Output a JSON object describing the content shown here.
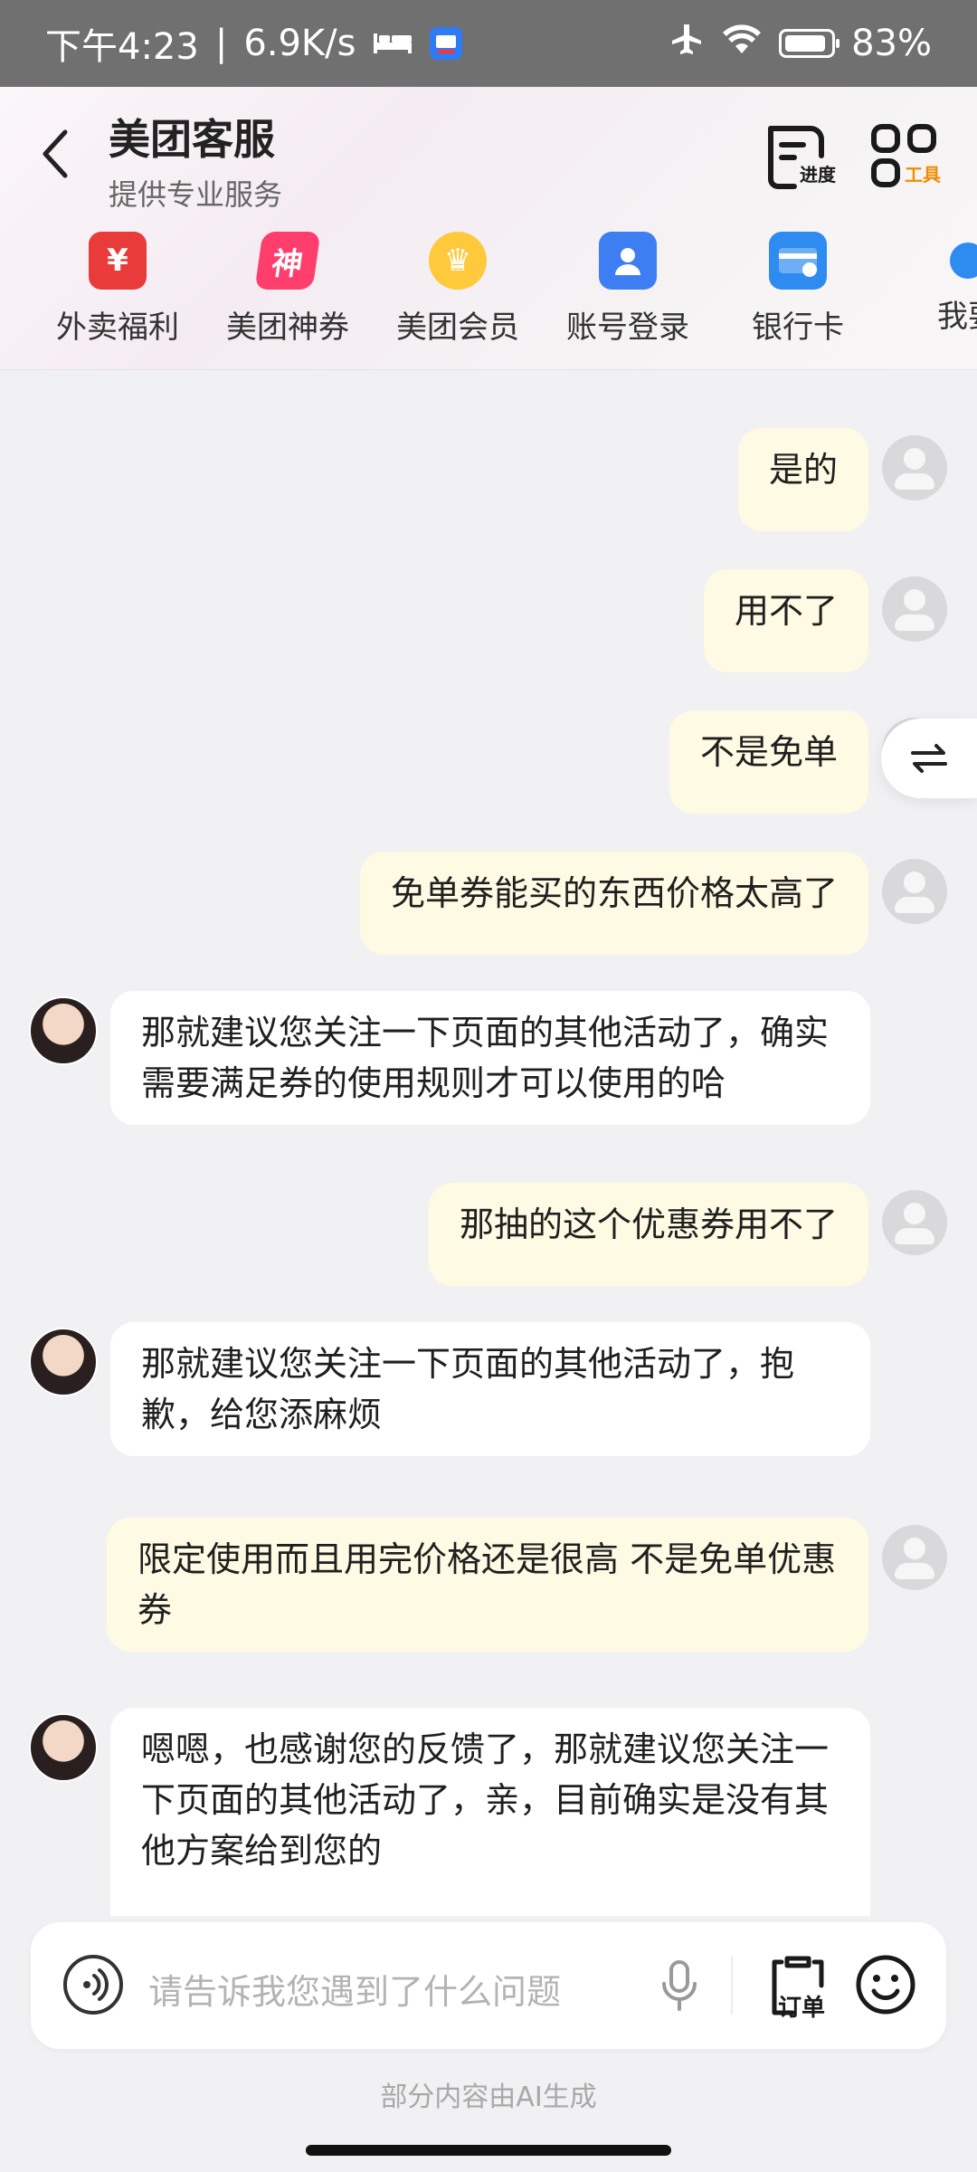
{
  "status_bar": {
    "time": "下午4:23",
    "net_speed": "6.9K/s",
    "battery": "83%"
  },
  "header": {
    "title": "美团客服",
    "subtitle": "提供专业服务",
    "tools": [
      {
        "label": "进度",
        "color": "#1a1a1a"
      },
      {
        "label": "工具",
        "color": "#f08c00"
      }
    ],
    "quick_items": [
      {
        "label": "外卖福利",
        "icon": "red-envelope-icon",
        "color": "#ea3b3b",
        "glyph": "¥"
      },
      {
        "label": "美团神券",
        "icon": "coupon-icon",
        "color": "#ff3e6d",
        "glyph": "神"
      },
      {
        "label": "美团会员",
        "icon": "member-planet-icon",
        "color": "#ffc93c",
        "glyph": "♛"
      },
      {
        "label": "账号登录",
        "icon": "account-icon",
        "color": "#3d7ff2",
        "glyph": "👤"
      },
      {
        "label": "银行卡",
        "icon": "bank-card-icon",
        "color": "#2e8bf0",
        "glyph": "💳"
      },
      {
        "label": "我要",
        "icon": "more-icon",
        "color": "#2e8bf0",
        "glyph": ""
      }
    ]
  },
  "messages": [
    {
      "from": "user",
      "text": "是的"
    },
    {
      "from": "user",
      "text": "用不了"
    },
    {
      "from": "user",
      "text": "不是免单"
    },
    {
      "from": "user",
      "text": "免单券能买的东西价格太高了"
    },
    {
      "from": "agent",
      "text": "那就建议您关注一下页面的其他活动了，确实需要满足券的使用规则才可以使用的哈"
    },
    {
      "from": "user",
      "text": "那抽的这个优惠券用不了"
    },
    {
      "from": "agent",
      "text": "那就建议您关注一下页面的其他活动了，抱歉，给您添麻烦"
    },
    {
      "from": "user",
      "text": "限定使用而且用完价格还是很高 不是免单优惠券"
    },
    {
      "from": "agent",
      "text": "嗯嗯，也感谢您的反馈了，那就建议您关注一下页面的其他活动了，亲，目前确实是没有其他方案给到您的"
    }
  ],
  "input": {
    "placeholder": "请告诉我您遇到了什么问题",
    "order_label": "订单"
  },
  "footer": {
    "ai_note": "部分内容由AI生成"
  }
}
